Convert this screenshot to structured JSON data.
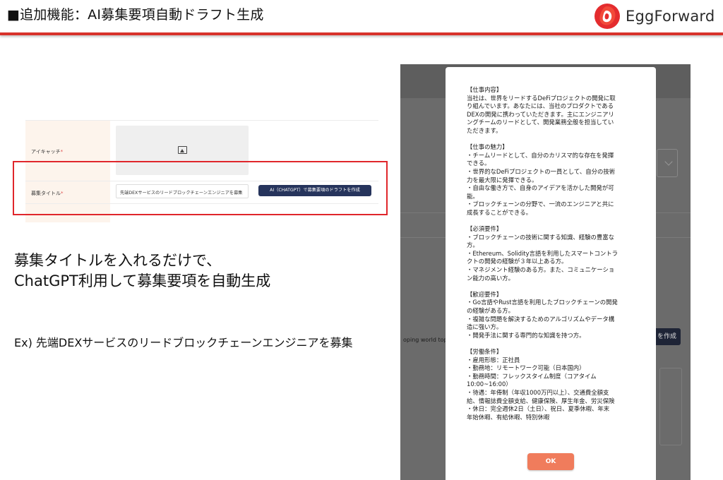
{
  "header": {
    "title": "■追加機能：AI募集要項自動ドラフト生成",
    "logo_text": "EggForward",
    "accent_color": "#d8322b"
  },
  "form": {
    "eyecatch_label": "アイキャッチ",
    "required_mark": "*",
    "title_label": "募集タイトル",
    "title_value": "先端DEXサービスのリードブロックチェーンエンジニアを募集",
    "ai_button_label": "AI（CHATGPT）で募集要項のドラフトを作成",
    "image_placeholder_icon": "image-icon"
  },
  "caption": {
    "line1": "募集タイトルを入れるだけで、",
    "line2": "ChatGPT利用して募集要項を自動生成"
  },
  "example": "Ex) 先端DEXサービスのリードブロックチェーンエンジニアを募集",
  "background_app": {
    "partial_text": "oping world top",
    "partial_button": "を作成"
  },
  "modal": {
    "sections": [
      {
        "lines": [
          "【仕事内容】",
          "当社は、世界をリードするDeFiプロジェクトの開発に取",
          "り組んでいます。あなたには、当社のプロダクトである",
          "DEXの開発に携わっていただきます。主にエンジニアリ",
          "ングチームのリードとして、開発業務全般を担当してい",
          "ただきます。"
        ]
      },
      {
        "lines": [
          "【仕事の魅力】",
          "・チームリードとして、自分のカリスマ的な存在を発揮",
          "できる。",
          "・世界的なDeFiプロジェクトの一員として、自分の技術",
          "力を最大限に発揮できる。",
          "・自由な働き方で、自身のアイデアを活かした開発が可",
          "能。",
          "・ブロックチェーンの分野で、一流のエンジニアと共に",
          "成長することができる。"
        ]
      },
      {
        "lines": [
          "【必須要件】",
          "・ブロックチェーンの技術に関する知識、経験の豊富な",
          "方。",
          "・Ethereum、Solidity言語を利用したスマートコントラ",
          "クトの開発の経験が３年以上ある方。",
          "・マネジメント経験のある方。また、コミュニケーショ",
          "ン能力の高い方。"
        ]
      },
      {
        "lines": [
          "【歓迎要件】",
          "・Go言語やRust言語を利用したブロックチェーンの開発",
          "の経験がある方。",
          "・複雑な問題を解決するためのアルゴリズムやデータ構",
          "造に強い方。",
          "・開発手法に関する専門的な知識を持つ方。"
        ]
      },
      {
        "lines": [
          "【労働条件】",
          "・雇用形態：正社員",
          "・勤務地：リモートワーク可能（日本国内）",
          "・勤務時間：フレックスタイム制度（コアタイム",
          "10:00~16:00）",
          "・待遇：年俸制（年収1000万円以上）、交通費全額支",
          "給、情報誌費全額支給、健康保険、厚生年金、労災保険",
          "・休日：完全週休2日（土日）、祝日、夏季休暇、年末",
          "年始休暇、有給休暇、特別休暇"
        ]
      }
    ],
    "ok_label": "OK",
    "ok_color": "#f07c5c"
  }
}
